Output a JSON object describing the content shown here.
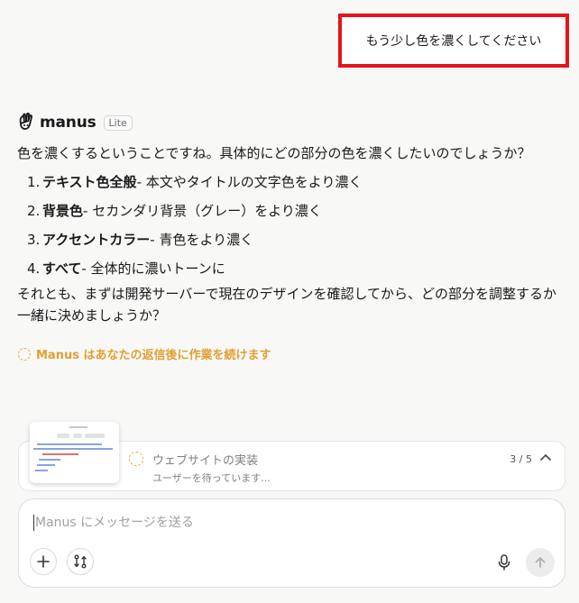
{
  "user_message": "もう少し色を濃くしてください",
  "assistant": {
    "name": "manus",
    "badge": "Lite",
    "intro": "色を濃くするということですね。具体的にどの部分の色を濃くしたいのでしょうか？",
    "options": [
      {
        "num": "1.",
        "title": "テキスト色全般",
        "desc": " - 本文やタイトルの文字色をより濃く"
      },
      {
        "num": "2.",
        "title": "背景色",
        "desc": " - セカンダリ背景（グレー）をより濃く"
      },
      {
        "num": "3.",
        "title": "アクセントカラー",
        "desc": " - 青色をより濃く"
      },
      {
        "num": "4.",
        "title": "すべて",
        "desc": " - 全体的に濃いトーンに"
      }
    ],
    "closing": "それとも、まずは開発サーバーで現在のデザインを確認してから、どの部分を調整するか一緒に決めましょうか？"
  },
  "status_text": "Manus はあなたの返信後に作業を続けます",
  "task": {
    "title": "ウェブサイトの実装",
    "subtitle": "ユーザーを待っています...",
    "progress": "3 / 5"
  },
  "composer": {
    "placeholder": "Manus にメッセージを送る"
  },
  "icons": {
    "logo": "manus-hand-icon",
    "spinner": "loading-spinner-icon",
    "collapse": "chevron-up-icon",
    "add": "plus-icon",
    "tools": "connector-icon",
    "mic": "microphone-icon",
    "send": "arrow-up-icon"
  },
  "colors": {
    "highlight_border": "#e5141c",
    "status": "#e0a030",
    "background": "#f8f8f7"
  }
}
